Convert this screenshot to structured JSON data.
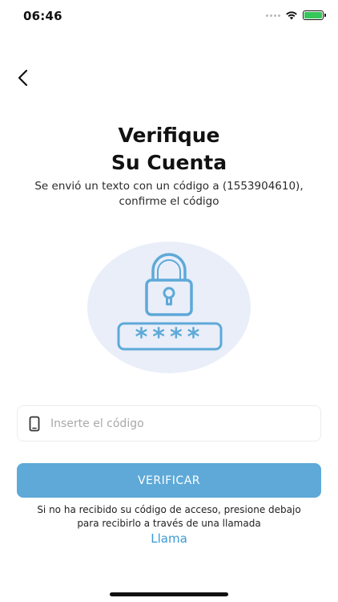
{
  "status_bar": {
    "time": "06:46"
  },
  "header": {
    "title_line1": "Verifique",
    "title_line2": "Su Cuenta",
    "subtitle_line1": "Se envió un texto con un código a (1553904610),",
    "subtitle_line2": "confirme el código"
  },
  "illustration": {
    "masked_code": "****",
    "circle_color": "#e9eef9",
    "stroke_color": "#5ea9d8"
  },
  "code_input": {
    "placeholder": "Inserte el código",
    "value": ""
  },
  "verify_button": {
    "label": "VERIFICAR",
    "color": "#5ea9d8"
  },
  "help": {
    "line1": "Si no ha recibido su código de acceso, presione debajo",
    "line2": "para recibirlo a través de una llamada",
    "call_label": "Llama",
    "link_color": "#3b9ad6"
  },
  "icons": [
    "chevron-left-icon",
    "wifi-icon",
    "battery-icon",
    "lock-icon",
    "phone-icon"
  ]
}
